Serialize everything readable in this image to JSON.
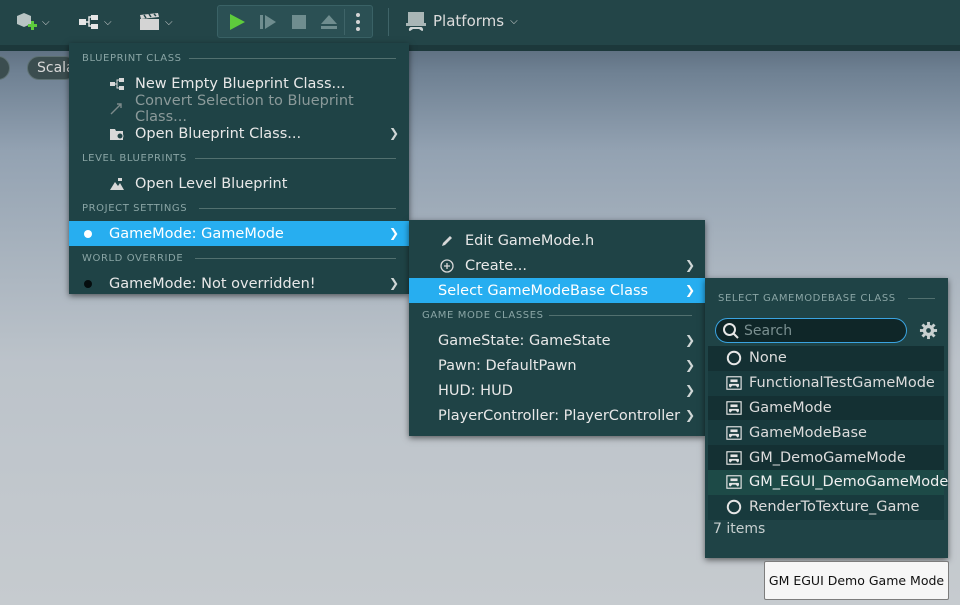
{
  "toolbar": {
    "platforms_label": "Platforms",
    "icons": [
      "add-content-icon",
      "blueprint-icon",
      "cinematics-icon",
      "play-icon",
      "advance-frame-icon",
      "stop-icon",
      "eject-icon",
      "more-options-icon",
      "platforms-icon"
    ]
  },
  "viewport": {
    "scalability_label": "Scala"
  },
  "blueprint_menu": {
    "sections": [
      {
        "header": "BLUEPRINT CLASS"
      },
      {
        "header": "LEVEL BLUEPRINTS"
      },
      {
        "header": "PROJECT SETTINGS"
      },
      {
        "header": "WORLD OVERRIDE"
      }
    ],
    "items": {
      "new_empty": "New Empty Blueprint Class...",
      "convert": "Convert Selection to Blueprint Class...",
      "open_class": "Open Blueprint Class...",
      "open_level": "Open Level Blueprint",
      "gamemode_project": "GameMode: GameMode",
      "gamemode_world": "GameMode: Not overridden!"
    }
  },
  "gamemode_menu": {
    "edit": "Edit GameMode.h",
    "create": "Create...",
    "select": "Select GameModeBase Class",
    "classes_header": "GAME MODE CLASSES",
    "gamestate": "GameState: GameState",
    "pawn": "Pawn: DefaultPawn",
    "hud": "HUD: HUD",
    "playercontroller": "PlayerController: PlayerController"
  },
  "class_picker": {
    "header": "SELECT GAMEMODEBASE CLASS",
    "search_placeholder": "Search",
    "items": [
      {
        "label": "None",
        "icon": "none-circle-icon"
      },
      {
        "label": "FunctionalTestGameMode",
        "icon": "gamemode-class-icon"
      },
      {
        "label": "GameMode",
        "icon": "gamemode-class-icon"
      },
      {
        "label": "GameModeBase",
        "icon": "gamemode-class-icon"
      },
      {
        "label": "GM_DemoGameMode",
        "icon": "gamemode-class-icon"
      },
      {
        "label": "GM_EGUI_DemoGameMode",
        "icon": "gamemode-class-icon"
      },
      {
        "label": "RenderToTexture_Game",
        "icon": "none-circle-icon"
      }
    ],
    "selected_index": 5,
    "count": "7 items"
  },
  "tooltip": {
    "text": "GM EGUI Demo Game Mode"
  },
  "colors": {
    "highlight": "#27aef0",
    "menu_bg": "#1f4346",
    "toolbar_bg": "#234548",
    "play_green": "#5ecb3c"
  }
}
